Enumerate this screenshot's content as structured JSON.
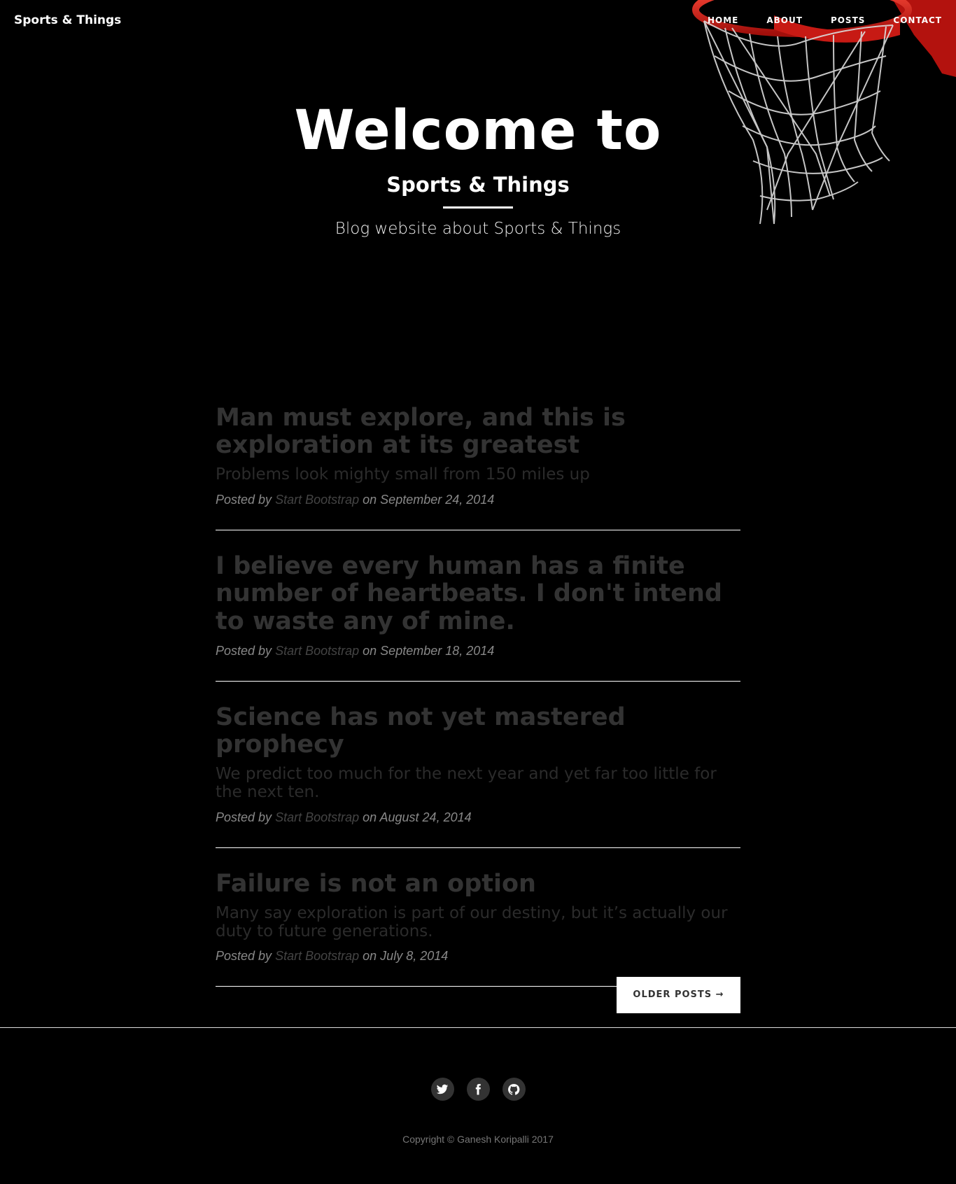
{
  "nav": {
    "brand": "Sports & Things",
    "links": [
      "HOME",
      "ABOUT",
      "POSTS",
      "CONTACT"
    ]
  },
  "hero": {
    "title": "Welcome to",
    "subtitle": "Sports & Things",
    "tagline": "Blog website about Sports & Things"
  },
  "posts": [
    {
      "title": "Man must explore, and this is exploration at its greatest",
      "subtitle": "Problems look mighty small from 150 miles up",
      "posted_by": "Posted by",
      "author": "Start Bootstrap",
      "date": "on September 24, 2014"
    },
    {
      "title": "I believe every human has a finite number of heartbeats. I don't intend to waste any of mine.",
      "subtitle": "",
      "posted_by": "Posted by",
      "author": "Start Bootstrap",
      "date": "on September 18, 2014"
    },
    {
      "title": "Science has not yet mastered prophecy",
      "subtitle": "We predict too much for the next year and yet far too little for the next ten.",
      "posted_by": "Posted by",
      "author": "Start Bootstrap",
      "date": "on August 24, 2014"
    },
    {
      "title": "Failure is not an option",
      "subtitle": "Many say exploration is part of our destiny, but it’s actually our duty to future generations.",
      "posted_by": "Posted by",
      "author": "Start Bootstrap",
      "date": "on July 8, 2014"
    }
  ],
  "pager": {
    "older_label": "OLDER POSTS →"
  },
  "footer": {
    "social_icons": [
      "twitter-icon",
      "facebook-icon",
      "github-icon"
    ],
    "copyright": "Copyright © Ganesh Koripalli 2017"
  },
  "colors": {
    "background": "#000000",
    "hoop_red": "#d8231e",
    "post_title": "#333333"
  }
}
